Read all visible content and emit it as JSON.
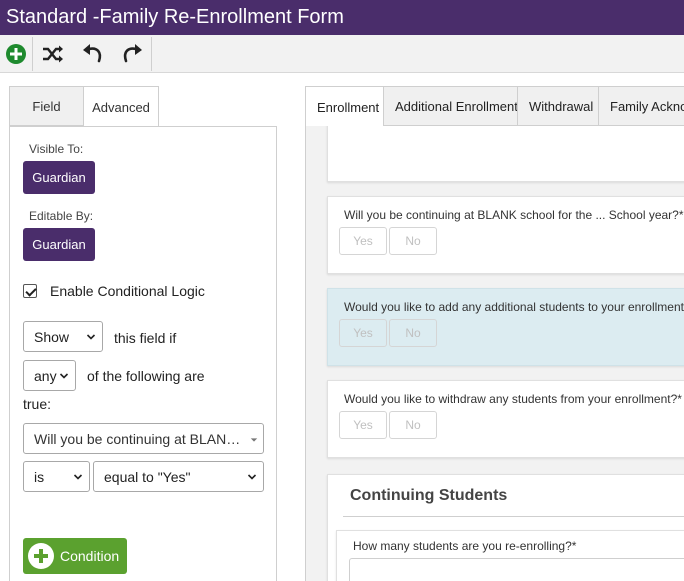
{
  "app": {
    "title": "Standard -Family Re-Enrollment Form"
  },
  "toolbar": {
    "add_icon": "plus-circle-icon",
    "shuffle_icon": "shuffle-icon",
    "undo_icon": "undo-icon",
    "redo_icon": "redo-icon",
    "add_color": "#1e8a2e"
  },
  "left_tabs": [
    {
      "label": "Field",
      "active": false
    },
    {
      "label": "Advanced",
      "active": true
    }
  ],
  "advanced": {
    "visible_to_label": "Visible To:",
    "visible_to_value": "Guardian",
    "editable_by_label": "Editable By:",
    "editable_by_value": "Guardian",
    "badge_color": "#4a2d6b",
    "conditional_logic_label": "Enable Conditional Logic",
    "conditional_logic_checked": true,
    "action_select": "Show",
    "action_suffix": "this field if",
    "quantifier_select": "any",
    "quantifier_suffix": "of the following are",
    "true_label": "true:",
    "condition_field": "Will you be continuing at BLAN…",
    "condition_operator": "is",
    "condition_value": "equal to \"Yes\"",
    "add_condition_label": "Condition",
    "add_condition_color": "#5ba12f"
  },
  "right_tabs": [
    {
      "label": "Enrollment",
      "active": true
    },
    {
      "label": "Additional Enrollment",
      "active": false
    },
    {
      "label": "Withdrawal",
      "active": false
    },
    {
      "label": "Family Acknow",
      "active": false
    }
  ],
  "form": {
    "questions": [
      {
        "text": "Will you be continuing at BLANK school for the ... School year?*",
        "yes": "Yes",
        "no": "No",
        "highlighted": false
      },
      {
        "text": "Would you like to add any additional students to your enrollment?*",
        "yes": "Yes",
        "no": "No",
        "highlighted": true
      },
      {
        "text": "Would you like to withdraw any students from your enrollment?*",
        "yes": "Yes",
        "no": "No",
        "highlighted": false
      }
    ],
    "section_title": "Continuing Students",
    "students_question": "How many students are you re-enrolling?*",
    "highlight_color": "#dcecf1"
  }
}
